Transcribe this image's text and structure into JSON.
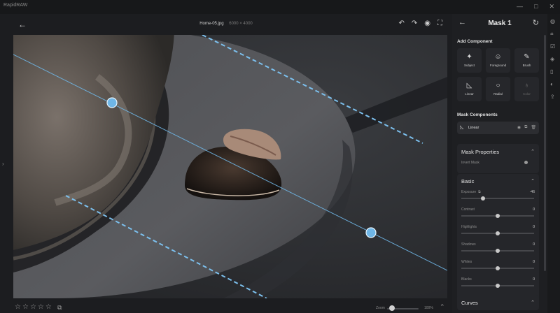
{
  "app": {
    "name": "RapidRAW",
    "window_controls": [
      "—",
      "□",
      "✕"
    ]
  },
  "topbar": {
    "back_icon": "arrow-left-icon",
    "file_name": "Home-05.jpg",
    "file_dims": "6000 × 4000",
    "tools": [
      {
        "name": "undo-icon",
        "glyph": "↶"
      },
      {
        "name": "redo-icon",
        "glyph": "↷"
      },
      {
        "name": "eye-icon",
        "glyph": "◉"
      },
      {
        "name": "fullscreen-icon",
        "glyph": "⛶"
      }
    ]
  },
  "canvas": {
    "mask_type": "Linear"
  },
  "bottombar": {
    "rating": 0,
    "star_glyph": "☆",
    "copy_icon": "⧉",
    "zoom_label": "Zoom",
    "zoom_value": "100%",
    "zoom_level": 0.15,
    "collapse_icon": "⌃"
  },
  "panel": {
    "title": "Mask 1",
    "back_icon": "←",
    "reset_icon": "↻",
    "add_component": {
      "title": "Add Component",
      "items": [
        {
          "label": "Subject",
          "icon": "✦",
          "disabled": false
        },
        {
          "label": "Foreground",
          "icon": "☺",
          "disabled": false
        },
        {
          "label": "Brush",
          "icon": "✎",
          "disabled": false
        },
        {
          "label": "Linear",
          "icon": "◺",
          "disabled": false
        },
        {
          "label": "Radial",
          "icon": "○",
          "disabled": false
        },
        {
          "label": "Color",
          "icon": "♁",
          "disabled": true
        }
      ]
    },
    "mask_components": {
      "title": "Mask Components",
      "item": {
        "label": "Linear",
        "icon": "◺",
        "tools": [
          "◉",
          "⧉",
          "🗑"
        ]
      }
    },
    "mask_properties": {
      "title": "Mask Properties",
      "invert_label": "Invert Mask",
      "invert_on": false
    },
    "basic": {
      "title": "Basic",
      "sliders": [
        {
          "label": "Exposure",
          "value": "-46",
          "pos": 0.3
        },
        {
          "label": "Contrast",
          "value": "0",
          "pos": 0.5
        },
        {
          "label": "Highlights",
          "value": "0",
          "pos": 0.5
        },
        {
          "label": "Shadows",
          "value": "0",
          "pos": 0.5
        },
        {
          "label": "Whites",
          "value": "0",
          "pos": 0.5
        },
        {
          "label": "Blacks",
          "value": "0",
          "pos": 0.5
        }
      ]
    },
    "curves": {
      "title": "Curves"
    }
  },
  "rail": {
    "icons": [
      {
        "name": "adjust-icon",
        "glyph": "◍"
      },
      {
        "name": "crop-icon",
        "glyph": "⌗"
      },
      {
        "name": "checklist-icon",
        "glyph": "☑"
      },
      {
        "name": "layers-icon",
        "glyph": "◈"
      },
      {
        "name": "clipboard-icon",
        "glyph": "▯"
      },
      {
        "name": "mask-icon",
        "glyph": "◐"
      },
      {
        "name": "export-icon",
        "glyph": "⇪"
      }
    ]
  }
}
